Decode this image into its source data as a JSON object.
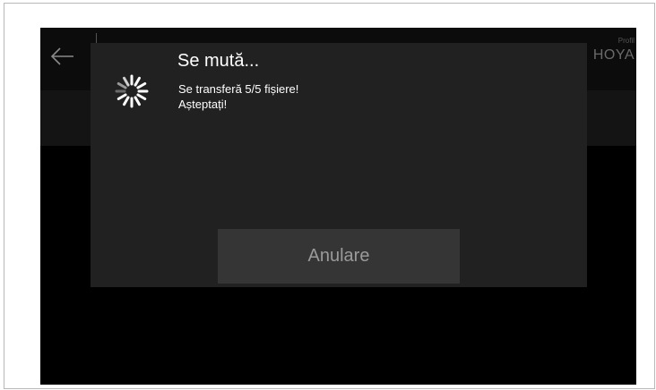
{
  "app": {
    "profile_label": "Profil",
    "profile_value": "HOYA"
  },
  "dialog": {
    "title": "Se mută...",
    "message": "Se transferă 5/5 fișiere!\nAșteptați!",
    "cancel_label": "Anulare"
  },
  "icons": {
    "back": "arrow-left-icon",
    "loading": "loading-spinner-icon"
  },
  "colors": {
    "screen_bg": "#000000",
    "dialog_bg": "#212121",
    "button_bg": "#353535",
    "button_text": "#9a9a9a",
    "text": "#ffffff"
  }
}
